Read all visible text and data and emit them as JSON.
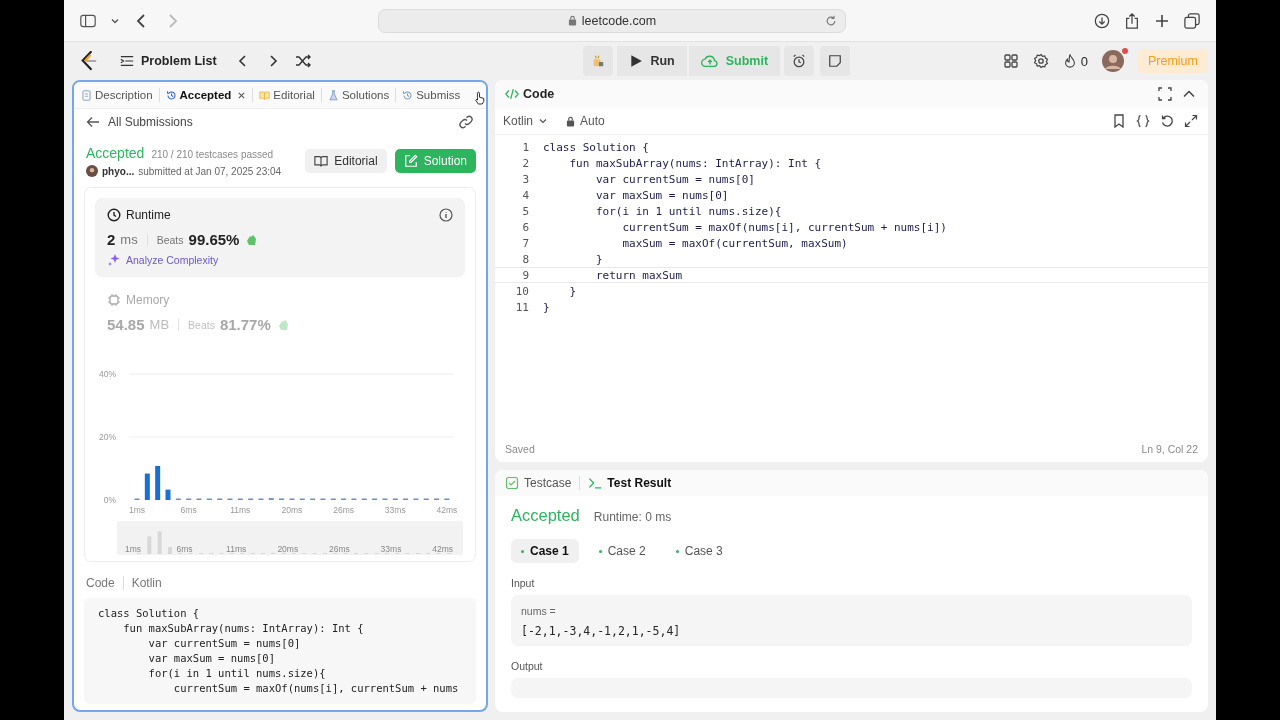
{
  "browser": {
    "url": "leetcode.com"
  },
  "nav": {
    "title": "Problem List",
    "run": "Run",
    "submit": "Submit",
    "streak": "0",
    "premium": "Premium"
  },
  "left_tabs": [
    {
      "label": "Description",
      "selected": false,
      "closable": false,
      "kind": "doc"
    },
    {
      "label": "Accepted",
      "selected": true,
      "closable": true,
      "kind": "history"
    },
    {
      "label": "Editorial",
      "selected": false,
      "closable": false,
      "kind": "book"
    },
    {
      "label": "Solutions",
      "selected": false,
      "closable": false,
      "kind": "flask"
    },
    {
      "label": "Submiss",
      "selected": false,
      "closable": false,
      "kind": "history"
    }
  ],
  "submission": {
    "back": "All Submissions",
    "status": "Accepted",
    "passed": "210 / 210 testcases passed",
    "user": "phyo...",
    "submitted": "submitted at Jan 07, 2025 23:04",
    "editorial": "Editorial",
    "solution": "Solution"
  },
  "stats": [
    {
      "label": "Runtime",
      "value": "2",
      "unit": "ms",
      "beats_label": "Beats",
      "beats": "99.65%",
      "analyze": "Analyze Complexity",
      "selected": true,
      "kind": "clock"
    },
    {
      "label": "Memory",
      "value": "54.85",
      "unit": "MB",
      "beats_label": "Beats",
      "beats": "81.77%",
      "selected": false,
      "kind": "chip"
    }
  ],
  "chart_data": {
    "type": "bar",
    "ylim": [
      0,
      40
    ],
    "yticks": [
      {
        "value": 0,
        "label": "0%"
      },
      {
        "value": 20,
        "label": "20%"
      },
      {
        "value": 40,
        "label": "40%"
      }
    ],
    "values": [
      0.1,
      8.4,
      10.8,
      3.3,
      0.1,
      0.1,
      0.1,
      0.1,
      0.1,
      0.1,
      0.1,
      0.1,
      0.1,
      0.6,
      0.5,
      0.1,
      0.1,
      0.1,
      0.1,
      0.3,
      0.1,
      0.1,
      0.1,
      0.1,
      0.1,
      0.1,
      0.1,
      0.1,
      0.1,
      0.1,
      0.1
    ]
  },
  "chart_axis_labels": [
    "1ms",
    "6ms",
    "11ms",
    "20ms",
    "26ms",
    "33ms",
    "42ms"
  ],
  "brush_labels": [
    "1ms",
    "6ms",
    "11ms",
    "20ms",
    "26ms",
    "33ms",
    "42ms"
  ],
  "code_view": {
    "label": "Code",
    "language": "Kotlin",
    "lines": [
      "class Solution {",
      "    fun maxSubArray(nums: IntArray): Int {",
      "        var currentSum = nums[0]",
      "        var maxSum = nums[0]",
      "        for(i in 1 until nums.size){",
      "            currentSum = maxOf(nums[i], currentSum + nums"
    ]
  },
  "editor": {
    "title": "Code",
    "language": "Kotlin",
    "mode": "Auto",
    "status": "Saved",
    "cursor": "Ln 9, Col 22",
    "lines": [
      {
        "num": "1",
        "text": "class Solution {",
        "current": false
      },
      {
        "num": "2",
        "text": "    fun maxSubArray(nums: IntArray): Int {",
        "current": false
      },
      {
        "num": "3",
        "text": "        var currentSum = nums[0]",
        "current": false
      },
      {
        "num": "4",
        "text": "        var maxSum = nums[0]",
        "current": false
      },
      {
        "num": "5",
        "text": "        for(i in 1 until nums.size){",
        "current": false
      },
      {
        "num": "6",
        "text": "            currentSum = maxOf(nums[i], currentSum + nums[i])",
        "current": false
      },
      {
        "num": "7",
        "text": "            maxSum = maxOf(currentSum, maxSum)",
        "current": false
      },
      {
        "num": "8",
        "text": "        }",
        "current": false
      },
      {
        "num": "9",
        "text": "        return maxSum",
        "current": true
      },
      {
        "num": "10",
        "text": "    }",
        "current": false
      },
      {
        "num": "11",
        "text": "}",
        "current": false
      }
    ]
  },
  "bottom_tabs": [
    {
      "label": "Testcase",
      "selected": false,
      "kind": "check"
    },
    {
      "label": "Test Result",
      "selected": true,
      "kind": "terminal"
    }
  ],
  "result": {
    "status": "Accepted",
    "runtime": "Runtime: 0 ms",
    "cases": [
      {
        "label": "Case 1",
        "selected": true
      },
      {
        "label": "Case 2",
        "selected": false
      },
      {
        "label": "Case 3",
        "selected": false
      }
    ],
    "input_label": "Input",
    "var": "nums =",
    "value": "[-2,1,-3,4,-1,2,1,-5,4]",
    "output_label": "Output"
  }
}
